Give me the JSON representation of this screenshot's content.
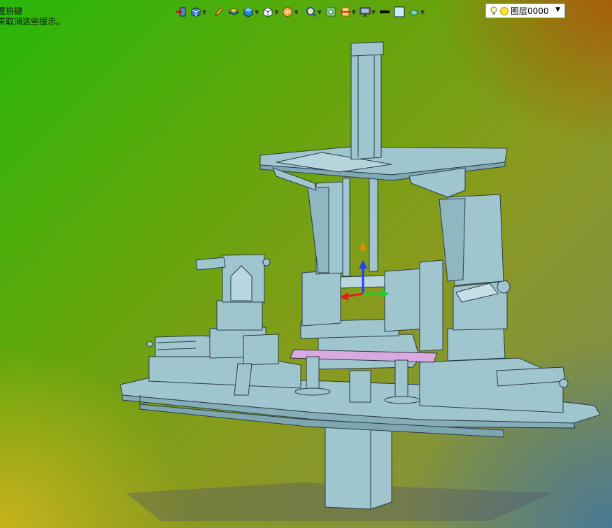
{
  "status_hints": [
    "置热键",
    "来取消这些提示。"
  ],
  "toolbar": {
    "buttons": [
      {
        "name": "exit-icon",
        "dropdown": false
      },
      {
        "name": "view-cube-icon",
        "dropdown": true
      },
      {
        "name": "pen-icon",
        "dropdown": false
      },
      {
        "name": "layers-stack-icon",
        "dropdown": false
      },
      {
        "name": "shaded-cube-icon",
        "dropdown": true
      },
      {
        "name": "wire-cube-icon",
        "dropdown": true
      },
      {
        "name": "render-sphere-icon",
        "dropdown": true
      },
      {
        "name": "zoom-icon",
        "dropdown": true
      },
      {
        "name": "zoom-fit-icon",
        "dropdown": false
      },
      {
        "name": "section-icon",
        "dropdown": true
      },
      {
        "name": "display-icon",
        "dropdown": true
      },
      {
        "name": "line-color-icon",
        "dropdown": false
      },
      {
        "name": "fill-color-icon",
        "dropdown": false
      },
      {
        "name": "material-icon",
        "dropdown": true
      }
    ],
    "layer": {
      "label": "图层0000",
      "bulb_icon": "bulb-icon",
      "color_icon": "layer-color-icon"
    }
  },
  "colors": {
    "model_face": "#9fc6cf",
    "model_edge": "#2b3b44",
    "gizmo_z": "#1f3cff",
    "gizmo_x": "#e0201c",
    "gizmo_y": "#1fcf2c"
  }
}
